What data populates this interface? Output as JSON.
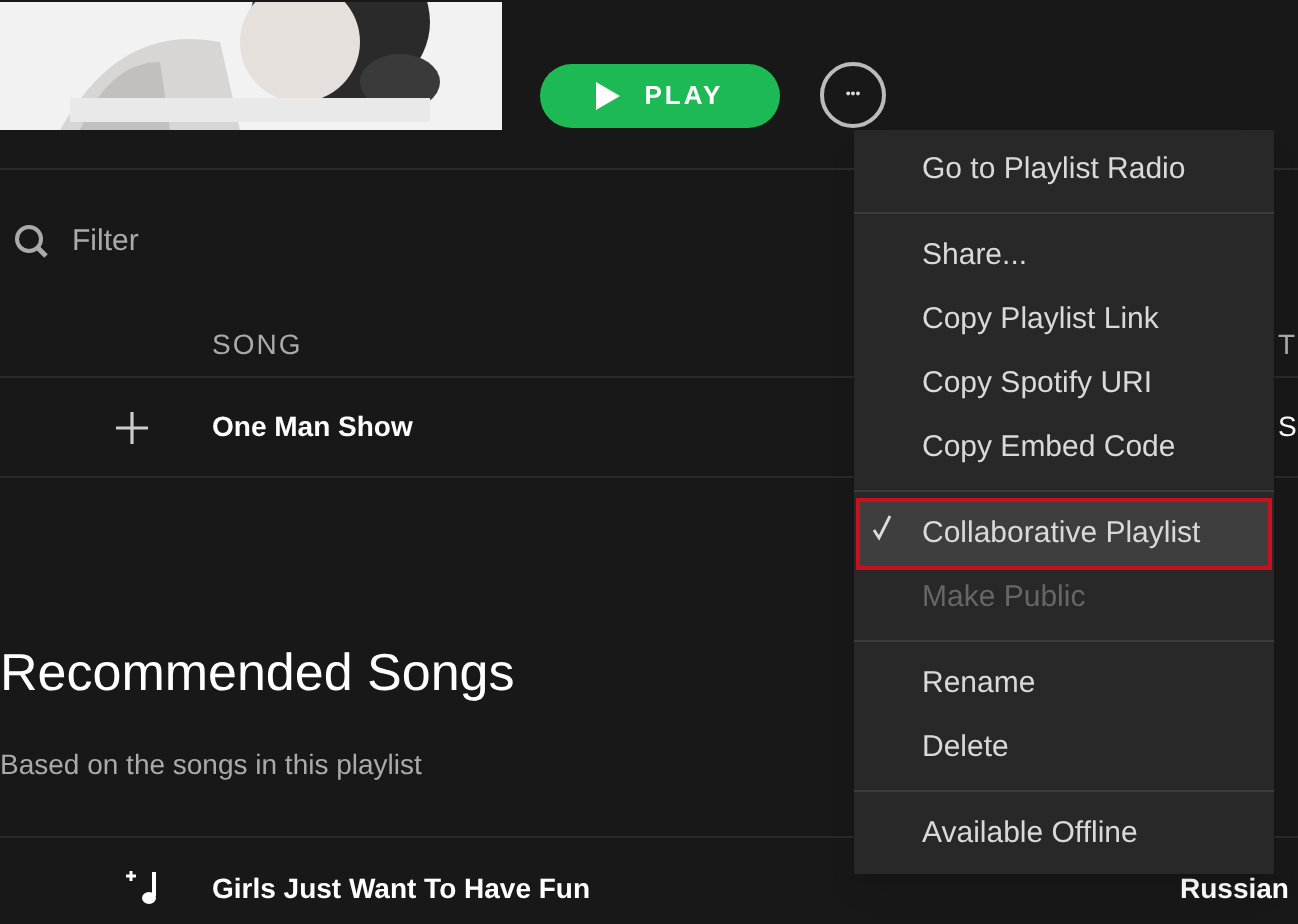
{
  "header": {
    "play_button": "PLAY",
    "more_button": "•••"
  },
  "filter": {
    "placeholder": "Filter"
  },
  "songs_table": {
    "columns": [
      "SONG",
      "T"
    ],
    "rows": [
      {
        "title": "One Man Show",
        "column_2": "S"
      }
    ]
  },
  "recommended": {
    "title": "Recommended Songs",
    "subtitle": "Based on the songs in this playlist",
    "rows": [
      {
        "title": "Girls Just Want To Have Fun",
        "column_2": "Russian"
      }
    ]
  },
  "context_menu": {
    "groups": [
      [
        {
          "label": "Go to Playlist Radio",
          "checked": false,
          "disabled": false,
          "selected": false
        }
      ],
      [
        {
          "label": "Share...",
          "checked": false,
          "disabled": false,
          "selected": false
        },
        {
          "label": "Copy Playlist Link",
          "checked": false,
          "disabled": false,
          "selected": false
        },
        {
          "label": "Copy Spotify URI",
          "checked": false,
          "disabled": false,
          "selected": false
        },
        {
          "label": "Copy Embed Code",
          "checked": false,
          "disabled": false,
          "selected": false
        }
      ],
      [
        {
          "label": "Collaborative Playlist",
          "checked": true,
          "disabled": false,
          "selected": true
        },
        {
          "label": "Make Public",
          "checked": false,
          "disabled": true,
          "selected": false
        }
      ],
      [
        {
          "label": "Rename",
          "checked": false,
          "disabled": false,
          "selected": false
        },
        {
          "label": "Delete",
          "checked": false,
          "disabled": false,
          "selected": false
        }
      ],
      [
        {
          "label": "Available Offline",
          "checked": false,
          "disabled": false,
          "selected": false
        }
      ]
    ]
  }
}
